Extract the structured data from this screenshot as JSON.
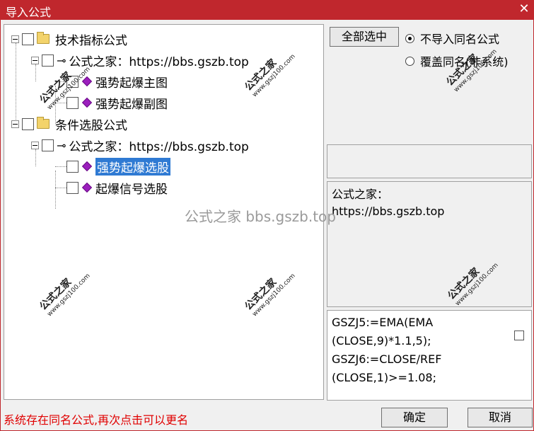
{
  "window": {
    "title": "导入公式",
    "close_glyph": "✕"
  },
  "tree": [
    {
      "label": "技术指标公式"
    },
    {
      "label": "公式之家：https://bbs.gszb.top"
    },
    {
      "label": "强势起爆主图"
    },
    {
      "label": "强势起爆副图"
    },
    {
      "label": "条件选股公式"
    },
    {
      "label": "公式之家：https://bbs.gszb.top"
    },
    {
      "label": "强势起爆选股",
      "selected": true
    },
    {
      "label": "起爆信号选股"
    }
  ],
  "buttons": {
    "select_all": "全部选中",
    "ok": "确定",
    "cancel": "取消"
  },
  "radios": [
    {
      "label": "不导入同名公式",
      "checked": true
    },
    {
      "label": "覆盖同名(非系统)",
      "checked": false
    }
  ],
  "info": {
    "line1": "公式之家：",
    "line2": "https://bbs.gszb.top"
  },
  "code": {
    "text": "GSZJ5:=EMA(EMA\n(CLOSE,9)*1.1,5);\nGSZJ6:=CLOSE/REF\n(CLOSE,1)>=1.08;"
  },
  "status": "系统存在同名公式,再次点击可以更名",
  "watermark": {
    "brand": "公式之家",
    "url": "www.gszj100.com",
    "center": "公式之家 bbs.gszb.top"
  },
  "colors": {
    "titlebar": "#c0272d",
    "selection": "#2f7ad3",
    "status_text": "#e00000",
    "gem": "#9b1fbd"
  }
}
